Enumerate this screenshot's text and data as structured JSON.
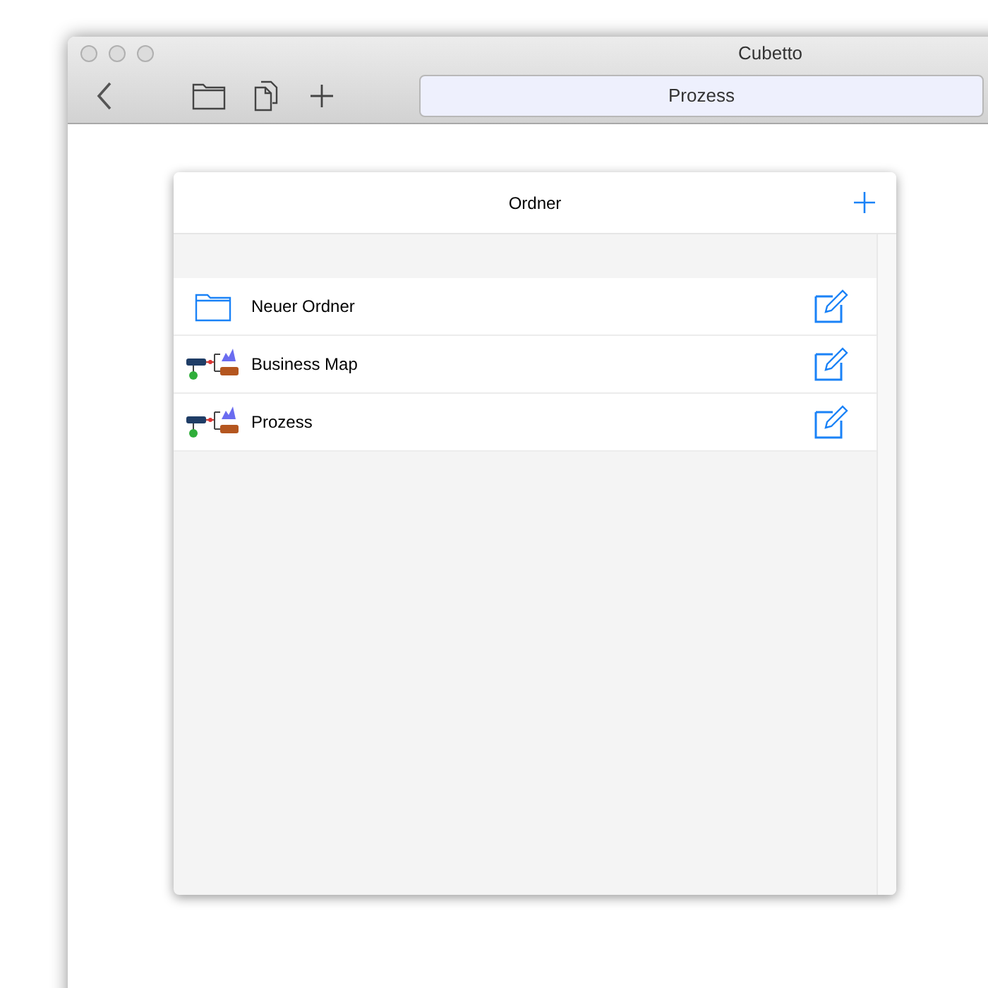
{
  "window": {
    "title": "Cubetto"
  },
  "toolbar": {
    "search": {
      "value": "Prozess"
    }
  },
  "panel": {
    "title": "Ordner",
    "items": [
      {
        "kind": "folder",
        "label": "Neuer Ordner"
      },
      {
        "kind": "map",
        "label": "Business Map"
      },
      {
        "kind": "map",
        "label": "Prozess"
      }
    ]
  }
}
